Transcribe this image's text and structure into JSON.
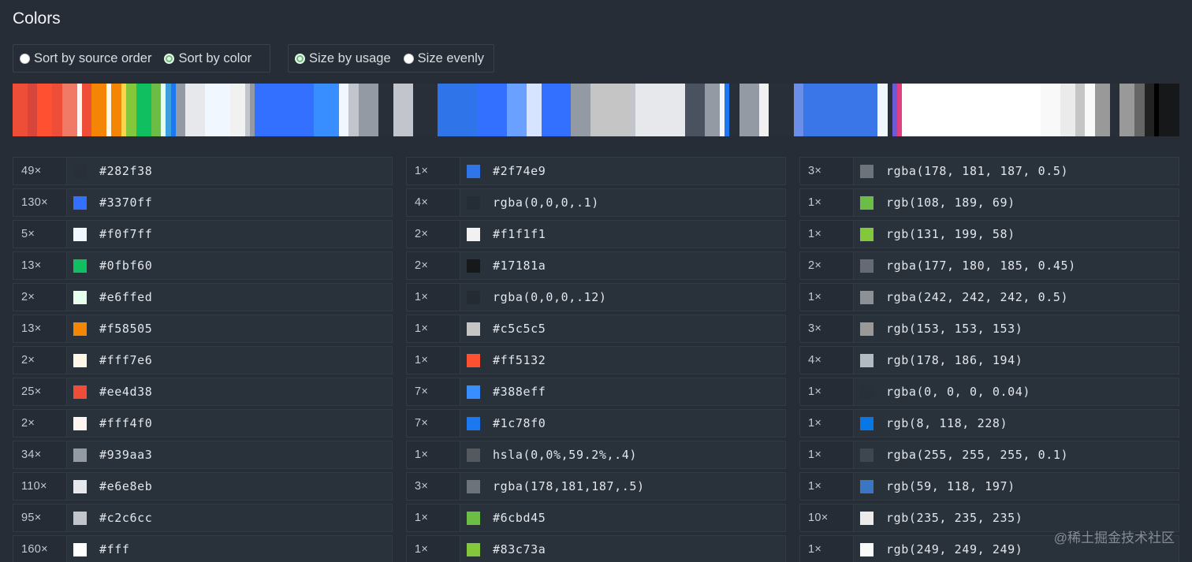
{
  "page": {
    "title": "Colors"
  },
  "controls": {
    "sort": [
      {
        "label": "Sort by source order",
        "checked": false
      },
      {
        "label": "Sort by color",
        "checked": true
      }
    ],
    "size": [
      {
        "label": "Size by usage",
        "checked": true
      },
      {
        "label": "Size evenly",
        "checked": false
      }
    ]
  },
  "colors": {
    "col1": [
      {
        "count": "49×",
        "value": "#282f38",
        "swatch": "#282f38"
      },
      {
        "count": "130×",
        "value": "#3370ff",
        "swatch": "#3370ff"
      },
      {
        "count": "5×",
        "value": "#f0f7ff",
        "swatch": "#f0f7ff"
      },
      {
        "count": "13×",
        "value": "#0fbf60",
        "swatch": "#0fbf60"
      },
      {
        "count": "2×",
        "value": "#e6ffed",
        "swatch": "#e6ffed"
      },
      {
        "count": "13×",
        "value": "#f58505",
        "swatch": "#f58505"
      },
      {
        "count": "2×",
        "value": "#fff7e6",
        "swatch": "#fff7e6"
      },
      {
        "count": "25×",
        "value": "#ee4d38",
        "swatch": "#ee4d38"
      },
      {
        "count": "2×",
        "value": "#fff4f0",
        "swatch": "#fff4f0"
      },
      {
        "count": "34×",
        "value": "#939aa3",
        "swatch": "#939aa3"
      },
      {
        "count": "110×",
        "value": "#e6e8eb",
        "swatch": "#e6e8eb"
      },
      {
        "count": "95×",
        "value": "#c2c6cc",
        "swatch": "#c2c6cc"
      },
      {
        "count": "160×",
        "value": "#fff",
        "swatch": "#ffffff"
      }
    ],
    "col2": [
      {
        "count": "1×",
        "value": "#2f74e9",
        "swatch": "#2f74e9"
      },
      {
        "count": "4×",
        "value": "rgba(0,0,0,.1)",
        "swatch": "rgba(0,0,0,0.1)"
      },
      {
        "count": "2×",
        "value": "#f1f1f1",
        "swatch": "#f1f1f1"
      },
      {
        "count": "2×",
        "value": "#17181a",
        "swatch": "#17181a"
      },
      {
        "count": "1×",
        "value": "rgba(0,0,0,.12)",
        "swatch": "rgba(0,0,0,0.12)"
      },
      {
        "count": "1×",
        "value": "#c5c5c5",
        "swatch": "#c5c5c5"
      },
      {
        "count": "1×",
        "value": "#ff5132",
        "swatch": "#ff5132"
      },
      {
        "count": "7×",
        "value": "#388eff",
        "swatch": "#388eff"
      },
      {
        "count": "7×",
        "value": "#1c78f0",
        "swatch": "#1c78f0"
      },
      {
        "count": "1×",
        "value": "hsla(0,0%,59.2%,.4)",
        "swatch": "hsla(0,0%,59.2%,0.4)"
      },
      {
        "count": "3×",
        "value": "rgba(178,181,187,.5)",
        "swatch": "rgba(178,181,187,0.5)"
      },
      {
        "count": "1×",
        "value": "#6cbd45",
        "swatch": "#6cbd45"
      },
      {
        "count": "1×",
        "value": "#83c73a",
        "swatch": "#83c73a"
      }
    ],
    "col3": [
      {
        "count": "3×",
        "value": "rgba(178, 181, 187, 0.5)",
        "swatch": "rgba(178,181,187,0.5)"
      },
      {
        "count": "1×",
        "value": "rgb(108, 189, 69)",
        "swatch": "rgb(108,189,69)"
      },
      {
        "count": "1×",
        "value": "rgb(131, 199, 58)",
        "swatch": "rgb(131,199,58)"
      },
      {
        "count": "2×",
        "value": "rgba(177, 180, 185, 0.45)",
        "swatch": "rgba(177,180,185,0.45)"
      },
      {
        "count": "1×",
        "value": "rgba(242, 242, 242, 0.5)",
        "swatch": "rgba(242,242,242,0.5)"
      },
      {
        "count": "3×",
        "value": "rgb(153, 153, 153)",
        "swatch": "rgb(153,153,153)"
      },
      {
        "count": "4×",
        "value": "rgb(178, 186, 194)",
        "swatch": "rgb(178,186,194)"
      },
      {
        "count": "1×",
        "value": "rgba(0, 0, 0, 0.04)",
        "swatch": "rgba(0,0,0,0.04)"
      },
      {
        "count": "1×",
        "value": "rgb(8, 118, 228)",
        "swatch": "rgb(8,118,228)"
      },
      {
        "count": "1×",
        "value": "rgba(255, 255, 255, 0.1)",
        "swatch": "rgba(255,255,255,0.1)"
      },
      {
        "count": "1×",
        "value": "rgb(59, 118, 197)",
        "swatch": "rgb(59,118,197)"
      },
      {
        "count": "10×",
        "value": "rgb(235, 235, 235)",
        "swatch": "rgb(235,235,235)"
      },
      {
        "count": "1×",
        "value": "rgb(249, 249, 249)",
        "swatch": "rgb(249,249,249)"
      }
    ]
  },
  "strip_colors": [
    "#ee4d38",
    "#d8453a",
    "#ff5132",
    "#ee4d38",
    "#f07a66",
    "#fff4f0",
    "#ee4d38",
    "#f58505",
    "#fff7e6",
    "#f58505",
    "#ffd24d",
    "#83c73a",
    "#0fbf60",
    "#6cbd45",
    "#e6ffed",
    "#3aa0e0",
    "#1c78f0",
    "#939aa3",
    "#e6e8eb",
    "#f0f7ff",
    "#f1f1f1",
    "#c2c6cc",
    "#939aa3",
    "#3370ff",
    "#388eff",
    "#f0f7ff",
    "#c2c6cc",
    "#939aa3",
    "#282f38",
    "#c2c6cc",
    "#282f38",
    "#2f74e9",
    "#3370ff",
    "#6aa0ff",
    "#d6e4ff",
    "#3370ff",
    "#939aa3",
    "#c5c5c5",
    "#c2c6cc",
    "#e6e8eb",
    "#4a5260",
    "#939aa3",
    "#f0f7ff",
    "#1c78f0",
    "#282f38",
    "#939aa3",
    "#f1f1f1",
    "#282f38",
    "#6b8ee8",
    "#3b76e8",
    "#f0f7ff",
    "#282f38",
    "#6b5bd6",
    "#e04080",
    "#fff",
    "#f9f9f9",
    "#ebebeb",
    "#c5c5c5",
    "#f9f9f9",
    "#999999",
    "#282f38",
    "#999999",
    "#666666",
    "#222222",
    "#000000",
    "#17181a"
  ],
  "watermark": "@稀土掘金技术社区"
}
